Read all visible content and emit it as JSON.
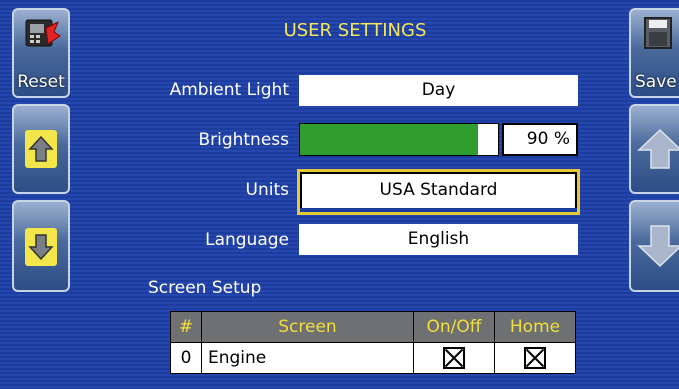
{
  "title": "USER SETTINGS",
  "left_buttons": {
    "reset_label": "Reset"
  },
  "right_buttons": {
    "save_label": "Save"
  },
  "settings": {
    "ambient_light": {
      "label": "Ambient Light",
      "value": "Day"
    },
    "brightness": {
      "label": "Brightness",
      "value": "90 %",
      "level": 0.9
    },
    "units": {
      "label": "Units",
      "value": "USA Standard"
    },
    "language": {
      "label": "Language",
      "value": "English"
    }
  },
  "screen_setup": {
    "label": "Screen Setup",
    "columns": [
      "#",
      "Screen",
      "On/Off",
      "Home"
    ],
    "rows": [
      {
        "num": "0",
        "screen": "Engine",
        "on_off": true,
        "home": true
      }
    ]
  },
  "colors": {
    "background": "#1c3c9e",
    "title": "#f4e65a",
    "brightness_fill": "#2f9e2f",
    "selected_border": "#e3c83a",
    "header_bg": "#6e7072",
    "header_text": "#f2df3c"
  },
  "icons": {
    "reset": "reset-device-icon",
    "up": "arrow-up-icon",
    "down": "arrow-down-icon",
    "save": "save-icon",
    "scroll_up": "scroll-up-icon",
    "scroll_down": "scroll-down-icon"
  }
}
